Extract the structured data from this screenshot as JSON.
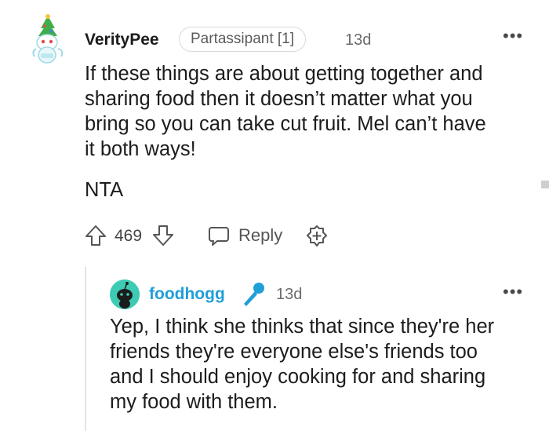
{
  "comment": {
    "username": "VerityPee",
    "flair": "Partassipant [1]",
    "time": "13d",
    "more": "•••",
    "body_lines": [
      "If these things are about getting together and",
      "sharing food then it doesn’t matter what you",
      "bring so you can take cut fruit. Mel can’t have",
      "it both ways!"
    ],
    "verdict": "NTA",
    "vote_count": "469",
    "reply_label": "Reply",
    "icons": {
      "upvote": "upvote-arrow-icon",
      "downvote": "downvote-arrow-icon",
      "reply": "speech-bubble-icon",
      "award": "award-plus-icon"
    }
  },
  "reply": {
    "username": "foodhogg",
    "time": "13d",
    "more": "•••",
    "body_lines": [
      "Yep, I think she thinks that since they're her",
      "friends they're everyone else's friends too",
      "and I should enjoy cooking for and sharing",
      "my food with them."
    ],
    "badge_icon": "microphone-icon"
  },
  "colors": {
    "text": "#1c1c1c",
    "muted": "#6b6b6b",
    "reply_username": "#1f9fd8",
    "avatar_teal": "#3ecbb3",
    "mic_blue": "#1f9fd8"
  }
}
